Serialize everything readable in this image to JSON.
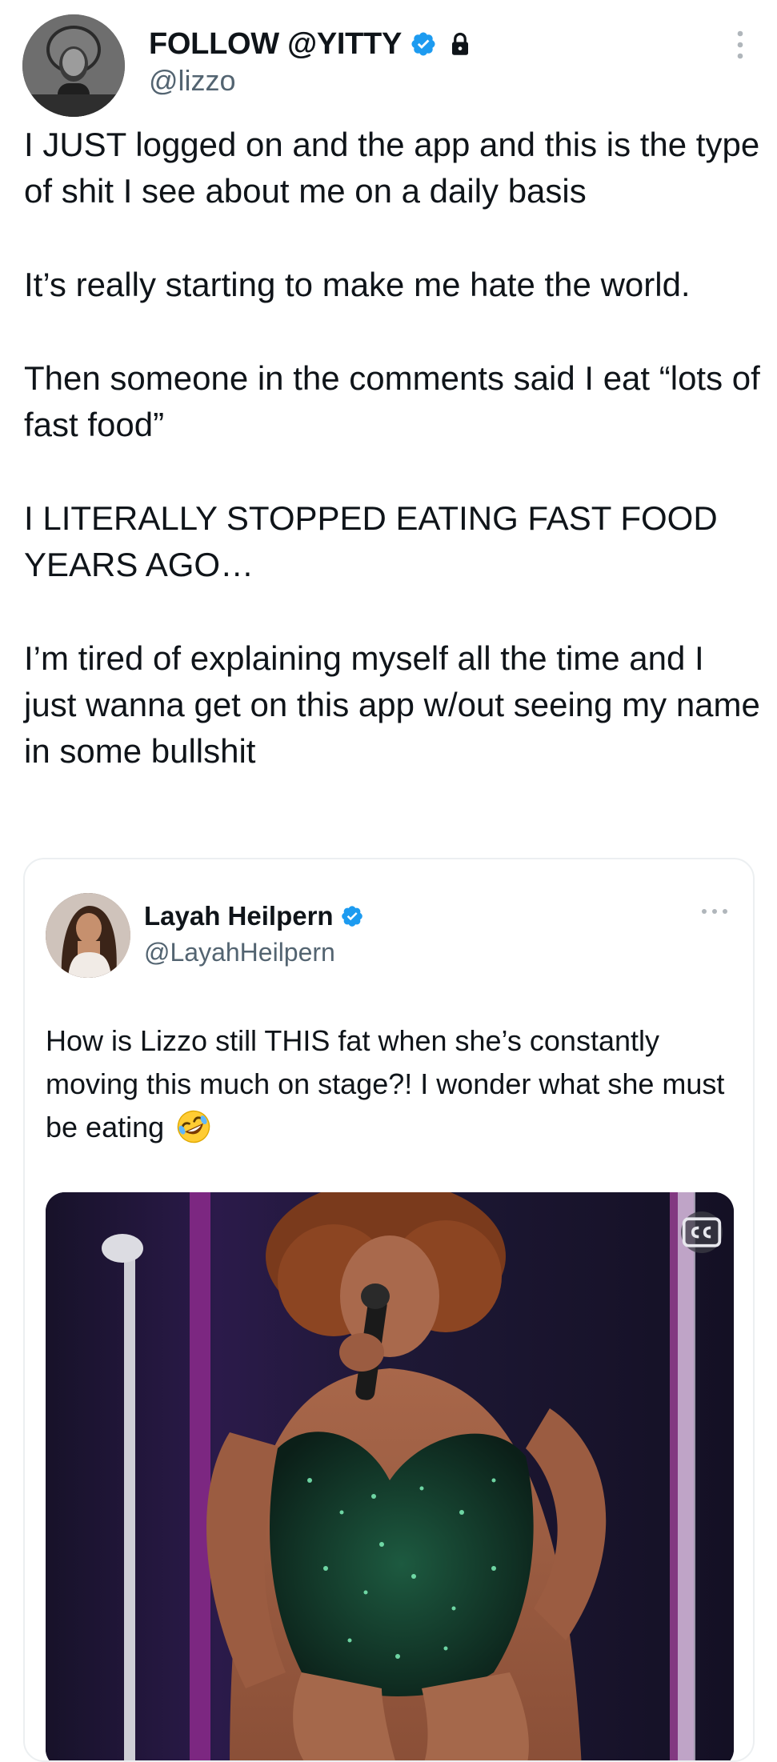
{
  "tweet": {
    "display_name": "FOLLOW @YITTY",
    "handle": "@lizzo",
    "paragraphs": [
      "I JUST logged on and the app and this is the type of shit I see about me on a daily basis",
      "It’s really starting to make me hate the world.",
      "Then someone in the comments said I eat “lots of fast food”",
      "I LITERALLY STOPPED EATING FAST FOOD YEARS AGO…",
      "I’m tired of explaining myself all the time and I just wanna get on this app w/out seeing my name in some bullshit"
    ]
  },
  "quoted_tweet": {
    "display_name": "Layah Heilpern",
    "handle": "@LayahHeilpern",
    "text": "How is Lizzo still THIS fat when she’s constantly moving this much on stage?! I wonder what she must be eating",
    "emoji_icon": "rolling-on-floor-laughing-icon",
    "media_badge_icon": "closed-captions-icon"
  },
  "icons": {
    "verified": "verified-badge-icon",
    "lock": "lock-icon",
    "more": "more-options-icon"
  },
  "colors": {
    "verified_blue": "#1d9bf0",
    "text_primary": "#0f1419",
    "text_secondary": "#536471",
    "border": "#eceff1"
  }
}
